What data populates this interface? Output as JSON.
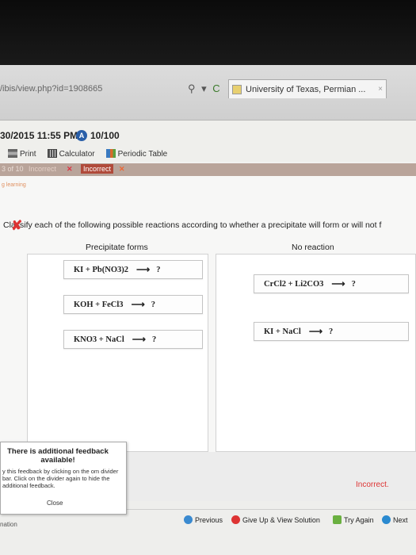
{
  "browser": {
    "url": "/ibis/view.php?id=1908665",
    "tab_title": "University of Texas, Permian ...",
    "tab_close": "×",
    "search_glyph": "⚲ ▾",
    "refresh_glyph": "C"
  },
  "header": {
    "date": "30/2015 11:55 PM",
    "score_glyph": "A",
    "score": "10/100",
    "toolbar": [
      {
        "label": "Print",
        "icon": "print-icon"
      },
      {
        "label": "Calculator",
        "icon": "calculator-icon"
      },
      {
        "label": "Periodic Table",
        "icon": "periodic-table-icon"
      }
    ]
  },
  "status": {
    "progress": "3 of 10",
    "attempt_1": "Incorrect",
    "attempt_2": "Incorrect",
    "mark": "✕"
  },
  "question": {
    "tag": "g learning",
    "text": "Classify each of the following possible reactions according to whether a precipitate will form or will not f",
    "wrong_mark": "✘",
    "columns": {
      "left": "Precipitate forms",
      "right": "No reaction"
    }
  },
  "reactions": {
    "left": [
      {
        "reactants": "KI + Pb(NO3)2",
        "arrow": "⟶",
        "product": "?"
      },
      {
        "reactants": "KOH + FeCl3",
        "arrow": "⟶",
        "product": "?"
      },
      {
        "reactants": "KNO3 + NaCl",
        "arrow": "⟶",
        "product": "?"
      }
    ],
    "right": [
      {
        "reactants": "CrCl2 + Li2CO3",
        "arrow": "⟶",
        "product": "?"
      },
      {
        "reactants": "KI + NaCl",
        "arrow": "⟶",
        "product": "?"
      }
    ]
  },
  "feedback": {
    "title": "There is additional feedback available!",
    "body": "y this feedback by clicking on the om divider bar. Click on the divider again to hide the additional feedback.",
    "close": "Close",
    "result": "Incorrect."
  },
  "footer": {
    "divider_label": "nation",
    "previous": "Previous",
    "give_up": "Give Up & View Solution",
    "try_again": "Try Again",
    "next": "Next"
  },
  "colors": {
    "error_red": "#dd3333",
    "status_bar": "#b9a49a",
    "score_blue": "#2a5fa8"
  }
}
